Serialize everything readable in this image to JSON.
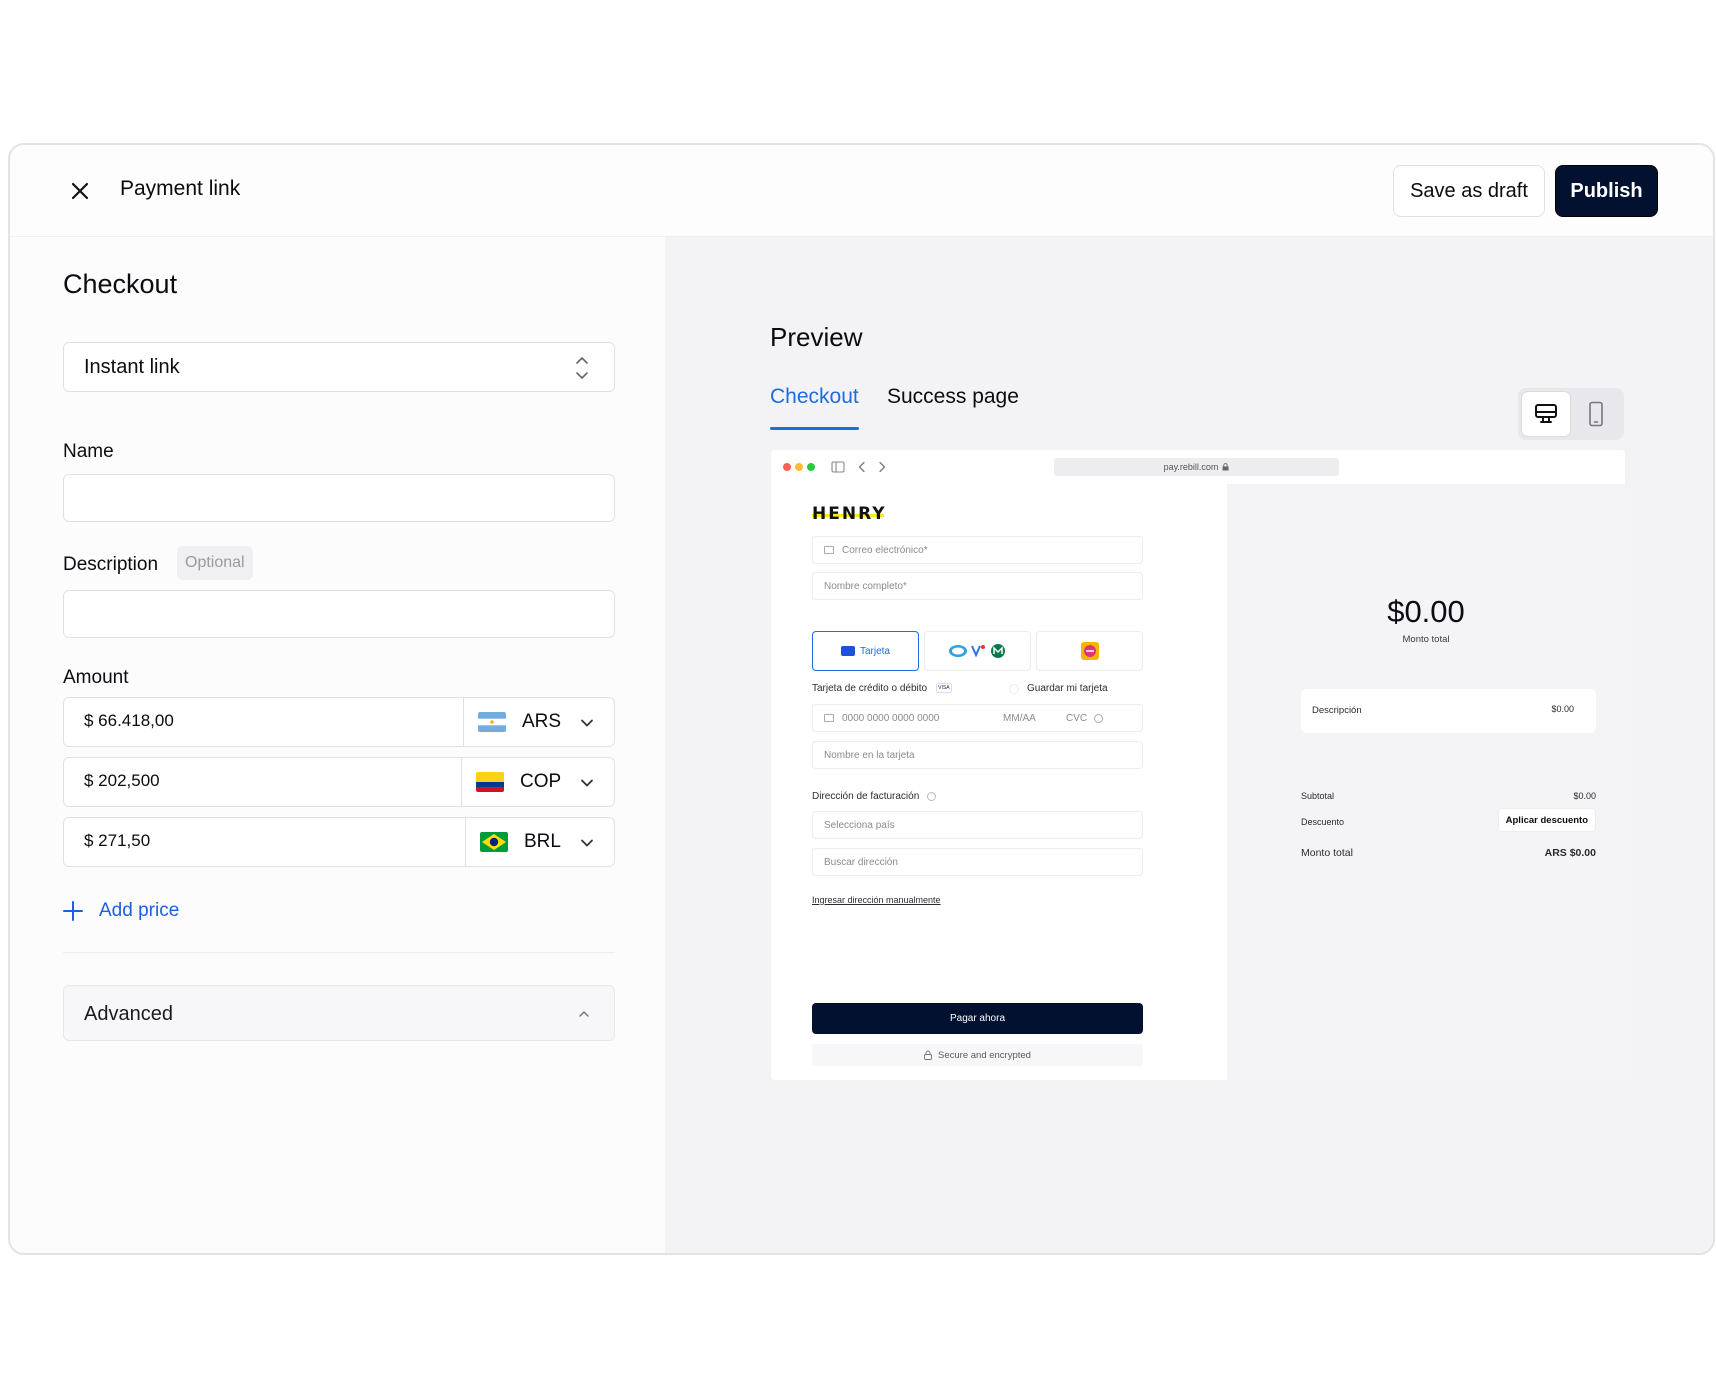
{
  "header": {
    "title": "Payment link",
    "save_draft": "Save as draft",
    "publish": "Publish"
  },
  "form": {
    "section_title": "Checkout",
    "link_type": "Instant link",
    "name_label": "Name",
    "name_value": "",
    "description_label": "Description",
    "description_optional": "Optional",
    "description_value": "",
    "amount_label": "Amount",
    "prices": [
      {
        "amount": "$ 66.418,00",
        "currency": "ARS"
      },
      {
        "amount": "$ 202,500",
        "currency": "COP"
      },
      {
        "amount": "$ 271,50",
        "currency": "BRL"
      }
    ],
    "add_price": "Add price",
    "advanced": "Advanced"
  },
  "preview": {
    "title": "Preview",
    "tabs": [
      "Checkout",
      "Success page"
    ],
    "active_tab": "Checkout",
    "device_selected": "desktop",
    "browser": {
      "url": "pay.rebill.com",
      "brand": "HENRY",
      "email_placeholder": "Correo electrónico*",
      "fullname_placeholder": "Nombre completo*",
      "method_card": "Tarjeta",
      "card_section": "Tarjeta de crédito o débito",
      "save_card": "Guardar mi tarjeta",
      "card_number_placeholder": "0000 0000 0000 0000",
      "expiry_placeholder": "MM/AA",
      "cvc_placeholder": "CVC",
      "card_name_placeholder": "Nombre en la tarjeta",
      "billing_label": "Dirección de facturación",
      "country_placeholder": "Selecciona país",
      "address_placeholder": "Buscar dirección",
      "manual_link": "Ingresar dirección manualmente",
      "pay_button": "Pagar ahora",
      "secure": "Secure and encrypted",
      "total_amount": "$0.00",
      "total_label": "Monto total",
      "desc_label": "Descripción",
      "desc_value": "$0.00",
      "subtotal_label": "Subtotal",
      "subtotal_value": "$0.00",
      "discount_label": "Descuento",
      "discount_button": "Aplicar descuento",
      "grand_label": "Monto total",
      "grand_value": "ARS $0.00"
    }
  }
}
